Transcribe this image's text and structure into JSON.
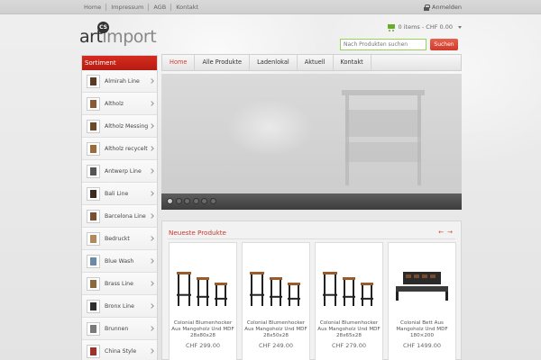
{
  "topbar": {
    "links": [
      "Home",
      "Impressum",
      "AGB",
      "Kontakt"
    ],
    "login_label": "Anmelden"
  },
  "logo": {
    "part1": "art",
    "part2": "import",
    "badge": "CS"
  },
  "cart": {
    "label": "0 items - CHF 0.00"
  },
  "search": {
    "placeholder": "Nach Produkten suchen",
    "button": "Suchen"
  },
  "sidebar": {
    "title": "Sortiment",
    "items": [
      {
        "label": "Almirah Line",
        "color": "#5a3a22"
      },
      {
        "label": "Altholz",
        "color": "#8a5a32"
      },
      {
        "label": "Altholz Messing",
        "color": "#6b4a2a"
      },
      {
        "label": "Altholz recycelt",
        "color": "#9a6a3a"
      },
      {
        "label": "Antwerp Line",
        "color": "#555555"
      },
      {
        "label": "Bali Line",
        "color": "#3a2a22"
      },
      {
        "label": "Barcelona Line",
        "color": "#7a5030"
      },
      {
        "label": "Bedruckt",
        "color": "#b08a5a"
      },
      {
        "label": "Blue Wash",
        "color": "#6a8aa8"
      },
      {
        "label": "Brass Line",
        "color": "#8a6a3a"
      },
      {
        "label": "Bronx Line",
        "color": "#2e2e2e"
      },
      {
        "label": "Brunnen",
        "color": "#7a7a7a"
      },
      {
        "label": "China Style",
        "color": "#a0302a"
      }
    ]
  },
  "nav": {
    "items": [
      "Home",
      "Alle Produkte",
      "Ladenlokal",
      "Aktuell",
      "Kontakt"
    ]
  },
  "slider": {
    "dots": 6,
    "active": 0
  },
  "products": {
    "title": "Neueste Produkte",
    "prev": "←",
    "next": "→",
    "items": [
      {
        "name": "Colonial Blumenhocker Aus Mangoholz Und MDF 28x80x28",
        "price": "CHF 299.00",
        "kind": "stools"
      },
      {
        "name": "Colonial Blumenhocker Aus Mangoholz Und MDF 28x50x28",
        "price": "CHF 249.00",
        "kind": "stools"
      },
      {
        "name": "Colonial Blumenhocker Aus Mangoholz Und MDF 28x65x28",
        "price": "CHF 279.00",
        "kind": "stools"
      },
      {
        "name": "Colonial Bett Aus Mangoholz Und MDF 180×200",
        "price": "CHF 1499.00",
        "kind": "bed"
      }
    ]
  }
}
